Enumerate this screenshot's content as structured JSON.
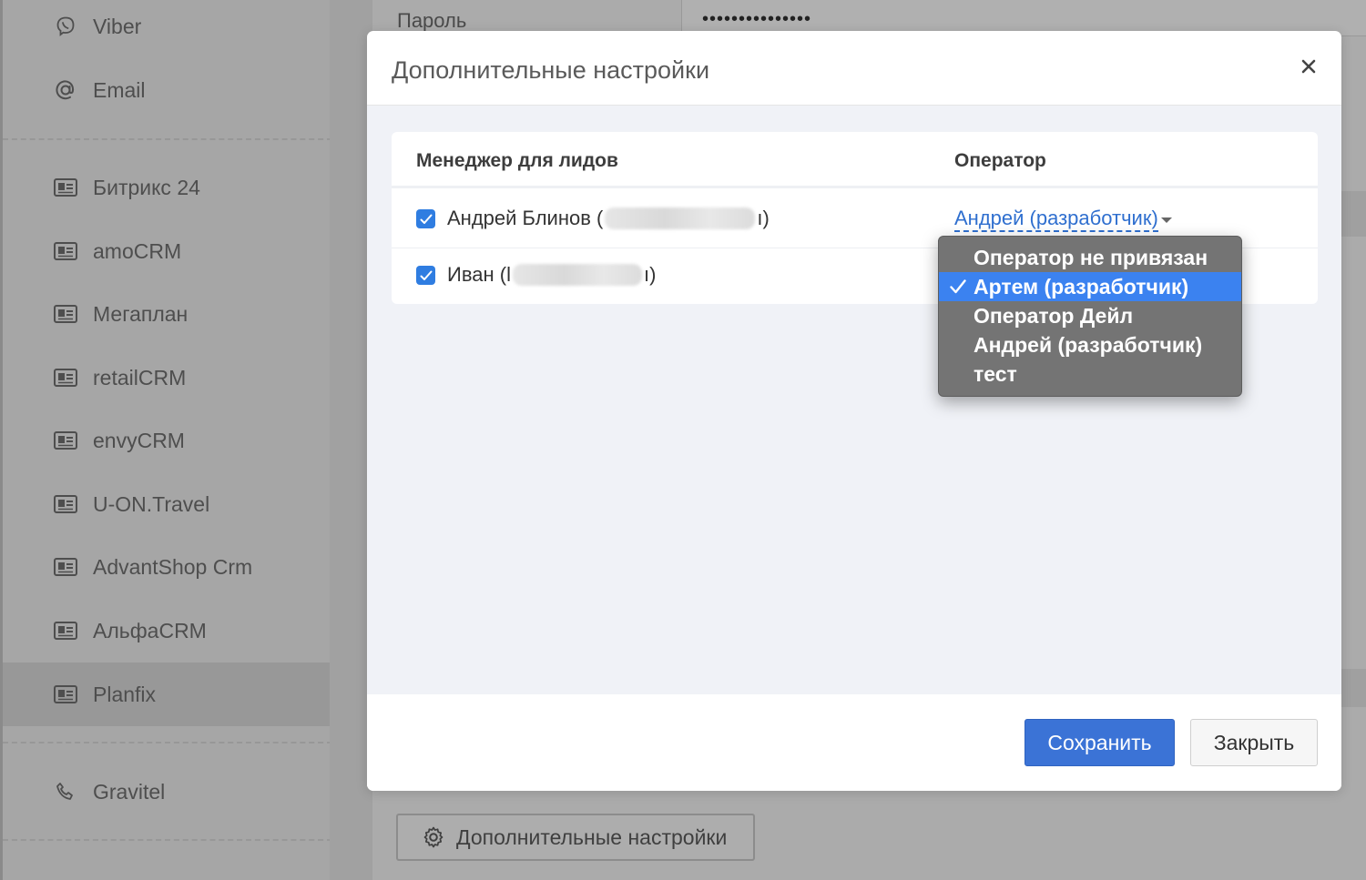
{
  "sidebar": {
    "items": [
      {
        "label": "Viber",
        "icon": "viber-icon"
      },
      {
        "label": "Email",
        "icon": "at-icon"
      },
      {
        "label": "Битрикс 24",
        "icon": "card-icon"
      },
      {
        "label": "amoCRM",
        "icon": "card-icon"
      },
      {
        "label": "Мегаплан",
        "icon": "card-icon"
      },
      {
        "label": "retailCRM",
        "icon": "card-icon"
      },
      {
        "label": "envyCRM",
        "icon": "card-icon"
      },
      {
        "label": "U-ON.Travel",
        "icon": "card-icon"
      },
      {
        "label": "AdvantShop Crm",
        "icon": "card-icon"
      },
      {
        "label": "АльфаCRM",
        "icon": "card-icon"
      },
      {
        "label": "Planfix",
        "icon": "card-icon",
        "active": true
      },
      {
        "label": "Gravitel",
        "icon": "phone-icon"
      }
    ]
  },
  "background": {
    "password_label": "Пароль",
    "password_value": "•••••••••••••••",
    "settings_button_label": "Дополнительные настройки"
  },
  "modal": {
    "title": "Дополнительные настройки",
    "table": {
      "col_manager": "Менеджер для лидов",
      "col_operator": "Оператор",
      "rows": [
        {
          "name_prefix": "Андрей Блинов (",
          "name_suffix": "ı)",
          "checked": true,
          "operator": "Андрей (разработчик)"
        },
        {
          "name_prefix": "Иван (l",
          "name_suffix": "ı)",
          "checked": true
        }
      ]
    },
    "dropdown": {
      "options": [
        {
          "label": "Оператор не привязан",
          "selected": false
        },
        {
          "label": "Артем (разработчик)",
          "selected": true
        },
        {
          "label": "Оператор Дейл",
          "selected": false
        },
        {
          "label": "Андрей (разработчик)",
          "selected": false
        },
        {
          "label": "тест",
          "selected": false
        }
      ]
    },
    "save_label": "Сохранить",
    "close_label": "Закрыть"
  },
  "colors": {
    "accent": "#3b73d6",
    "checkbox": "#2f7de1",
    "dropdown_selected": "#3b82f0",
    "link": "#2f6fcf"
  }
}
